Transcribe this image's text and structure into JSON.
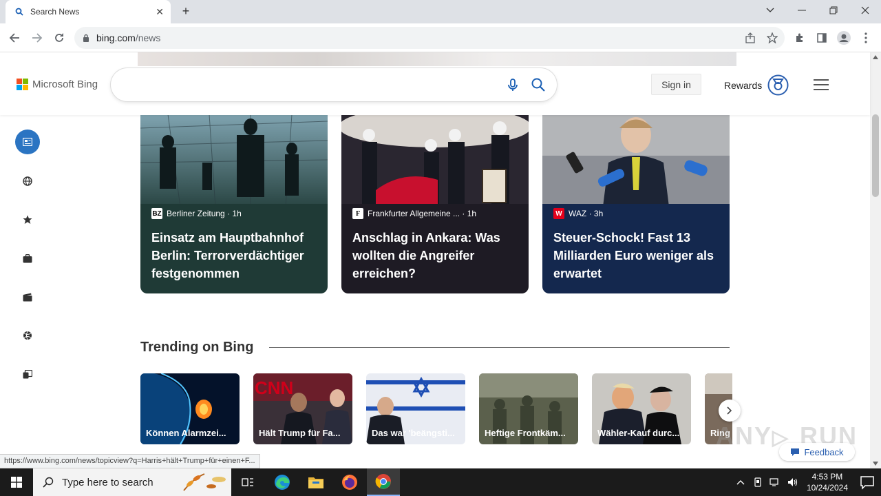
{
  "browser": {
    "tab_title": "Search News",
    "url_host": "bing.com",
    "url_path": "/news"
  },
  "header": {
    "logo_text": "Microsoft Bing",
    "search_placeholder": "",
    "signin_label": "Sign in",
    "rewards_label": "Rewards"
  },
  "sidebar": {
    "items": [
      {
        "icon": "news-icon",
        "active": true
      },
      {
        "icon": "globe-icon"
      },
      {
        "icon": "star-icon"
      },
      {
        "icon": "briefcase-icon"
      },
      {
        "icon": "clapperboard-icon"
      },
      {
        "icon": "sports-ball-icon"
      },
      {
        "icon": "tablet-icon"
      }
    ]
  },
  "cards": [
    {
      "source": "Berliner Zeitung",
      "age": "· 1h",
      "title": "Einsatz am Hauptbahnhof Berlin: Terrorverdächtiger festgenommen",
      "bg": "#1f3a36",
      "logo_bg": "#ffffff",
      "logo_color": "#000000",
      "logo_glyph": "BZ"
    },
    {
      "source": "Frankfurter Allgemeine ...",
      "age": "· 1h",
      "title": "Anschlag in Ankara: Was wollten die Angreifer erreichen?",
      "bg": "#1e1b24",
      "logo_bg": "#ffffff",
      "logo_color": "#000000",
      "logo_glyph": "F"
    },
    {
      "source": "WAZ",
      "age": "· 3h",
      "title": "Steuer-Schock! Fast 13 Milliarden Euro weniger als erwartet",
      "bg": "#14284e",
      "logo_bg": "#e3001b",
      "logo_color": "#ffffff",
      "logo_glyph": "W"
    }
  ],
  "trending": {
    "title": "Trending on Bing",
    "items": [
      {
        "label": "Können Alarmzei..."
      },
      {
        "label": "Hält Trump für Fa..."
      },
      {
        "label": "Das war 'beängsti..."
      },
      {
        "label": "Heftige Frontkäm..."
      },
      {
        "label": "Wähler-Kauf durc..."
      },
      {
        "label": "Ring"
      }
    ]
  },
  "status_url": "https://www.bing.com/news/topicview?q=Harris+hält+Trump+für+einen+F...",
  "feedback_label": "Feedback",
  "watermark": "ANY RUN",
  "taskbar": {
    "search_placeholder": "Type here to search",
    "time": "4:53 PM",
    "date": "10/24/2024"
  },
  "colors": {
    "accent": "#2b74c2",
    "rewards": "#2b5fb0"
  }
}
